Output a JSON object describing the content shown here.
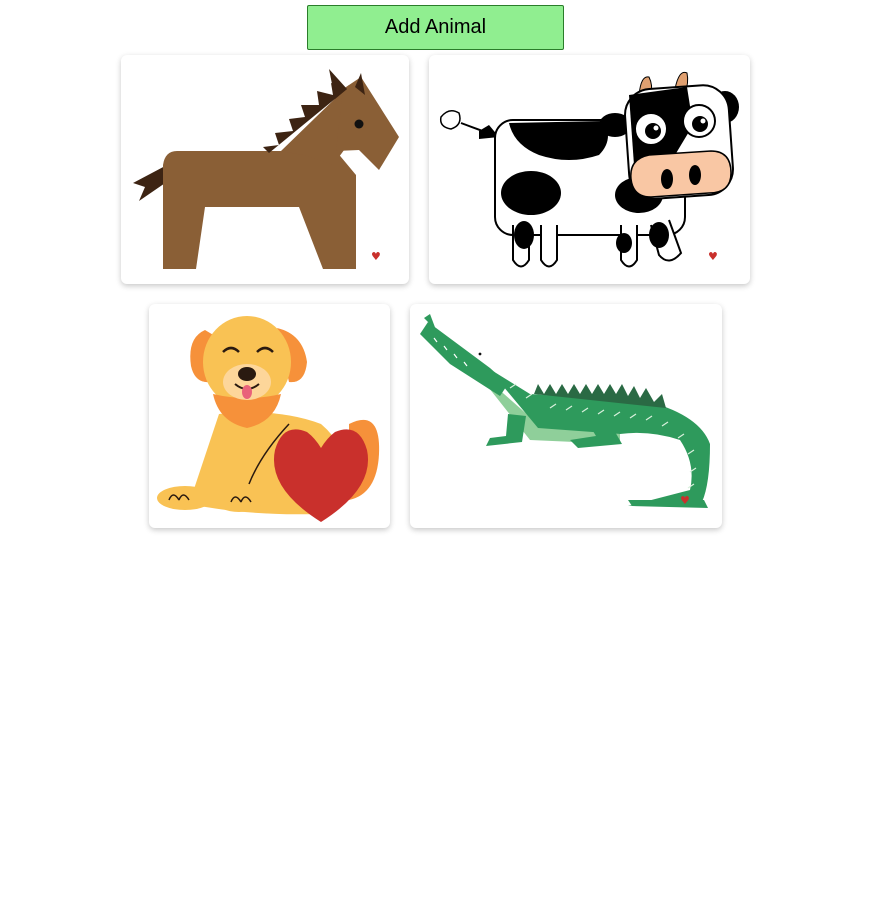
{
  "toolbar": {
    "add_label": "Add Animal",
    "add_color": "#90ee90"
  },
  "cards": [
    {
      "animal": "horse",
      "favorite_icon": "heart-icon",
      "favorite_glyph": "♥",
      "heart_color": "#c9302c"
    },
    {
      "animal": "cow",
      "favorite_icon": "heart-icon",
      "favorite_glyph": "♥",
      "heart_color": "#c9302c"
    },
    {
      "animal": "dog",
      "favorite_icon": "heart-icon",
      "favorite_glyph": "♥",
      "heart_color": "#c9302c"
    },
    {
      "animal": "crocodile",
      "favorite_icon": "heart-icon",
      "favorite_glyph": "♥",
      "heart_color": "#c9302c"
    }
  ]
}
